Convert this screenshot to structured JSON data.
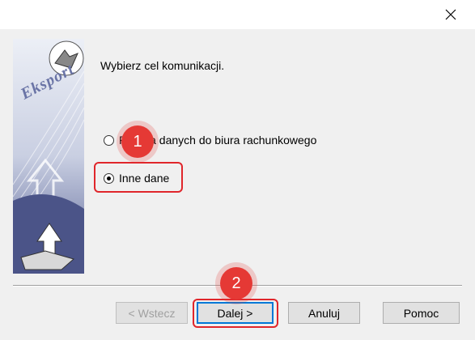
{
  "dialog": {
    "prompt": "Wybierz cel komunikacji.",
    "side_image_label": "Eksport"
  },
  "options": [
    {
      "label": "Paczka danych do biura rachunkowego",
      "selected": false
    },
    {
      "label": "Inne dane",
      "selected": true
    }
  ],
  "buttons": {
    "back": "< Wstecz",
    "next": "Dalej >",
    "cancel": "Anuluj",
    "help": "Pomoc"
  },
  "annotations": {
    "step1": "1",
    "step2": "2",
    "color": "#e53935"
  }
}
